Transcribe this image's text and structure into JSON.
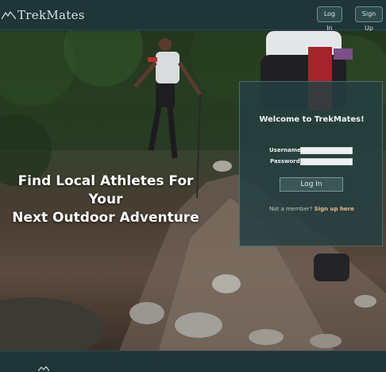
{
  "header": {
    "logo_text": "TrekMates",
    "login_label": "Log In",
    "signup_label": "Sign Up"
  },
  "hero": {
    "headline_line1": "Find Local Athletes For Your",
    "headline_line2": "Next Outdoor Adventure"
  },
  "login_panel": {
    "title": "Welcome to TrekMates!",
    "username_label": "Username:",
    "password_label": "Password:",
    "username_value": "",
    "password_value": "",
    "button_label": "Log In",
    "member_prompt": "Not a member?",
    "signup_link": "Sign up here"
  },
  "colors": {
    "bar_bg": "#1f3537",
    "panel_bg": "#244041",
    "accent_link": "#e5b98e"
  },
  "icons": {
    "logo": "mountain-icon",
    "footer": "mountain-icon"
  }
}
